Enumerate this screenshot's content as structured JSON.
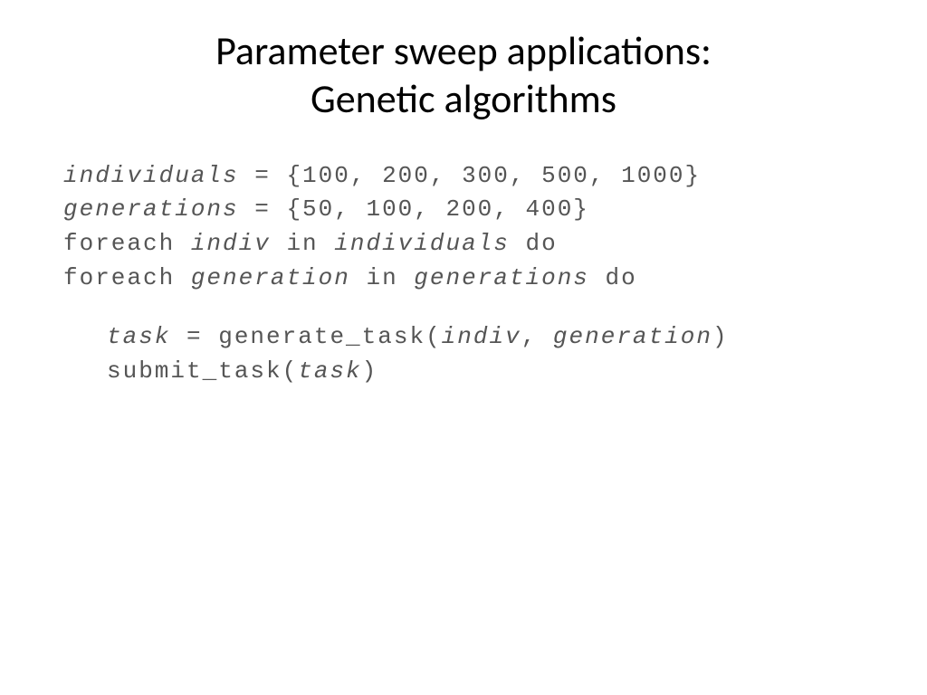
{
  "title_line1": "Parameter sweep applications:",
  "title_line2": "Genetic algorithms",
  "code": {
    "individuals_var": "individuals",
    "individuals_eq": " = {100, 200, 300, 500, 1000}",
    "generations_var": "generations",
    "generations_eq": " = {50, 100, 200, 400}",
    "foreach1_kw": "foreach ",
    "foreach1_var": "indiv",
    "foreach1_in": " in ",
    "foreach1_coll": "individuals",
    "foreach1_do": " do",
    "foreach2_kw": "foreach ",
    "foreach2_var": "generation",
    "foreach2_in": " in ",
    "foreach2_coll": "generations",
    "foreach2_do": " do",
    "task_var": "task",
    "task_eq": " = generate_task(",
    "task_arg1": "indiv",
    "task_comma": ", ",
    "task_arg2": "generation",
    "task_close": ")",
    "submit_kw": "submit_task(",
    "submit_arg": "task",
    "submit_close": ")"
  }
}
